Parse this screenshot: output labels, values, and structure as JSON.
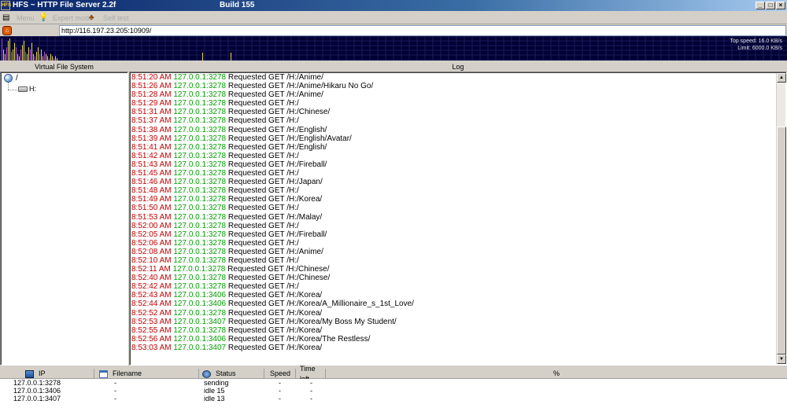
{
  "window": {
    "title": "HFS ~ HTTP File Server 2.2f",
    "build": "Build 155",
    "app_icon_text": "HFS"
  },
  "toolbar": {
    "items": [
      {
        "icon": "menu-icon",
        "label": "Menu"
      },
      {
        "icon": "lightbulb-icon",
        "label": "Expert mode"
      },
      {
        "icon": "people-icon",
        "label": "Self test"
      }
    ]
  },
  "url_bar": {
    "value": "http://116.197.23.205:10909/"
  },
  "graph": {
    "top_speed": "Top speed: 16.0 KB/s",
    "limit": "Limit: 6000.0 KB/s",
    "activity": [
      1,
      0.5,
      0.3,
      0.6,
      0.9,
      1,
      0.4,
      0.5,
      0.8,
      0.6,
      0.3,
      0.2,
      0.5,
      0.7,
      0.9,
      0.4,
      0.3,
      0.6,
      0.5,
      0.8,
      0.3,
      0.2,
      0.4,
      0.6,
      0.3,
      0.5,
      0.2,
      0.4,
      0.3,
      0.2,
      0.1,
      0.3,
      0.2,
      0.1,
      0.2,
      0.1
    ]
  },
  "panels": {
    "vfs_title": "Virtual File System",
    "log_title": "Log"
  },
  "vfs": {
    "root": "/",
    "children": [
      "H:"
    ]
  },
  "log": [
    {
      "time": "8:51:20 AM",
      "ip": "127.0.0.1:3278",
      "msg": "Requested GET /H:/Anime/"
    },
    {
      "time": "8:51:26 AM",
      "ip": "127.0.0.1:3278",
      "msg": "Requested GET /H:/Anime/Hikaru No Go/"
    },
    {
      "time": "8:51:28 AM",
      "ip": "127.0.0.1:3278",
      "msg": "Requested GET /H:/Anime/"
    },
    {
      "time": "8:51:29 AM",
      "ip": "127.0.0.1:3278",
      "msg": "Requested GET /H:/"
    },
    {
      "time": "8:51:31 AM",
      "ip": "127.0.0.1:3278",
      "msg": "Requested GET /H:/Chinese/"
    },
    {
      "time": "8:51:37 AM",
      "ip": "127.0.0.1:3278",
      "msg": "Requested GET /H:/"
    },
    {
      "time": "8:51:38 AM",
      "ip": "127.0.0.1:3278",
      "msg": "Requested GET /H:/English/"
    },
    {
      "time": "8:51:39 AM",
      "ip": "127.0.0.1:3278",
      "msg": "Requested GET /H:/English/Avatar/"
    },
    {
      "time": "8:51:41 AM",
      "ip": "127.0.0.1:3278",
      "msg": "Requested GET /H:/English/"
    },
    {
      "time": "8:51:42 AM",
      "ip": "127.0.0.1:3278",
      "msg": "Requested GET /H:/"
    },
    {
      "time": "8:51:43 AM",
      "ip": "127.0.0.1:3278",
      "msg": "Requested GET /H:/Fireball/"
    },
    {
      "time": "8:51:45 AM",
      "ip": "127.0.0.1:3278",
      "msg": "Requested GET /H:/"
    },
    {
      "time": "8:51:46 AM",
      "ip": "127.0.0.1:3278",
      "msg": "Requested GET /H:/Japan/"
    },
    {
      "time": "8:51:48 AM",
      "ip": "127.0.0.1:3278",
      "msg": "Requested GET /H:/"
    },
    {
      "time": "8:51:49 AM",
      "ip": "127.0.0.1:3278",
      "msg": "Requested GET /H:/Korea/"
    },
    {
      "time": "8:51:50 AM",
      "ip": "127.0.0.1:3278",
      "msg": "Requested GET /H:/"
    },
    {
      "time": "8:51:53 AM",
      "ip": "127.0.0.1:3278",
      "msg": "Requested GET /H:/Malay/"
    },
    {
      "time": "8:52:00 AM",
      "ip": "127.0.0.1:3278",
      "msg": "Requested GET /H:/"
    },
    {
      "time": "8:52:05 AM",
      "ip": "127.0.0.1:3278",
      "msg": "Requested GET /H:/Fireball/"
    },
    {
      "time": "8:52:06 AM",
      "ip": "127.0.0.1:3278",
      "msg": "Requested GET /H:/"
    },
    {
      "time": "8:52:08 AM",
      "ip": "127.0.0.1:3278",
      "msg": "Requested GET /H:/Anime/"
    },
    {
      "time": "8:52:10 AM",
      "ip": "127.0.0.1:3278",
      "msg": "Requested GET /H:/"
    },
    {
      "time": "8:52:11 AM",
      "ip": "127.0.0.1:3278",
      "msg": "Requested GET /H:/Chinese/"
    },
    {
      "time": "8:52:40 AM",
      "ip": "127.0.0.1:3278",
      "msg": "Requested GET /H:/Chinese/"
    },
    {
      "time": "8:52:42 AM",
      "ip": "127.0.0.1:3278",
      "msg": "Requested GET /H:/"
    },
    {
      "time": "8:52:43 AM",
      "ip": "127.0.0.1:3406",
      "msg": "Requested GET /H:/Korea/"
    },
    {
      "time": "8:52:44 AM",
      "ip": "127.0.0.1:3406",
      "msg": "Requested GET /H:/Korea/A_Millionaire_s_1st_Love/"
    },
    {
      "time": "8:52:52 AM",
      "ip": "127.0.0.1:3278",
      "msg": "Requested GET /H:/Korea/"
    },
    {
      "time": "8:52:53 AM",
      "ip": "127.0.0.1:3407",
      "msg": "Requested GET /H:/Korea/My Boss My Student/"
    },
    {
      "time": "8:52:55 AM",
      "ip": "127.0.0.1:3278",
      "msg": "Requested GET /H:/Korea/"
    },
    {
      "time": "8:52:56 AM",
      "ip": "127.0.0.1:3406",
      "msg": "Requested GET /H:/Korea/The Restless/"
    },
    {
      "time": "8:53:03 AM",
      "ip": "127.0.0.1:3407",
      "msg": "Requested GET /H:/Korea/"
    }
  ],
  "connections": {
    "columns": [
      "IP",
      "Filename",
      "Status",
      "Speed",
      "Time left",
      "%"
    ],
    "rows": [
      {
        "ip": "127.0.0.1:3278",
        "filename": "-",
        "status": "sending",
        "speed": "-",
        "time_left": "-"
      },
      {
        "ip": "127.0.0.1:3406",
        "filename": "-",
        "status": "idle 15",
        "speed": "-",
        "time_left": "-"
      },
      {
        "ip": "127.0.0.1:3407",
        "filename": "-",
        "status": "idle 13",
        "speed": "-",
        "time_left": "-"
      }
    ]
  },
  "colors": {
    "log_time": "#c00000",
    "log_ip": "#00a000",
    "graph_bg": "#000034",
    "graph_bar": "#e8d84a"
  }
}
